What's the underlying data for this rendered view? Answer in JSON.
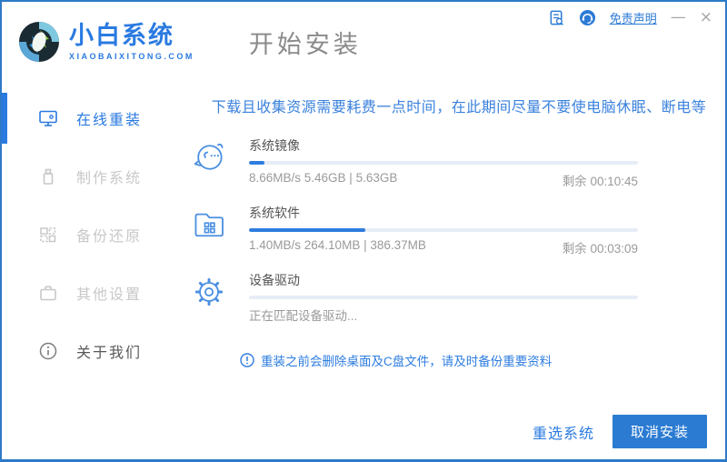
{
  "window": {
    "brand": {
      "name": "小白系统",
      "domain": "XIAOBAIXITONG.COM"
    },
    "page_title": "开始安装",
    "topbar": {
      "disclaimer_label": "免责声明",
      "minimize_label": "—",
      "close_label": "×"
    }
  },
  "sidebar": {
    "items": [
      {
        "label": "在线重装",
        "icon": "monitor-icon",
        "active": true
      },
      {
        "label": "制作系统",
        "icon": "usb-icon",
        "active": false
      },
      {
        "label": "备份还原",
        "icon": "backup-grid-icon",
        "active": false
      },
      {
        "label": "其他设置",
        "icon": "briefcase-icon",
        "active": false
      },
      {
        "label": "关于我们",
        "icon": "info-icon",
        "active": false
      }
    ]
  },
  "content": {
    "warning": "下载且收集资源需要耗费一点时间，在此期间尽量不要使电脑休眠、断电等",
    "tasks": [
      {
        "title": "系统镜像",
        "progress_percent": 4,
        "info": "8.66MB/s 5.46GB | 5.63GB",
        "remaining": "剩余 00:10:45"
      },
      {
        "title": "系统软件",
        "progress_percent": 30,
        "info": "1.40MB/s 264.10MB | 386.37MB",
        "remaining": "剩余 00:03:09"
      },
      {
        "title": "设备驱动",
        "progress_percent": 0,
        "info": "正在匹配设备驱动...",
        "remaining": ""
      }
    ],
    "note": "重装之前会删除桌面及C盘文件，请及时备份重要资料"
  },
  "footer": {
    "reselect_label": "重选系统",
    "cancel_label": "取消安装"
  },
  "colors": {
    "accent": "#2a7ae0",
    "button_fill": "#2b7bd2",
    "warning_text": "#3b82dd",
    "progress_track": "#e7edf6",
    "progress_fill": "#2e7de0",
    "inactive_gray": "#c8c8c8"
  }
}
